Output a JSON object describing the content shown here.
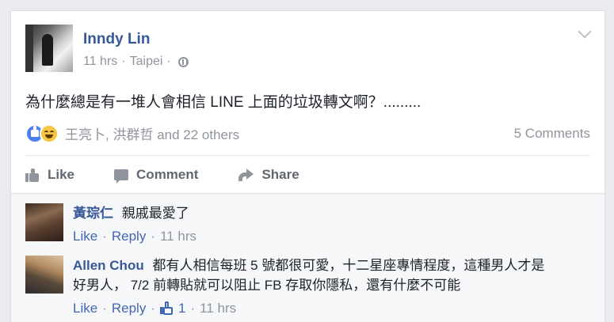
{
  "post": {
    "author": "Inndy Lin",
    "time": "11 hrs",
    "location": "Taipei",
    "text": "為什麼總是有一堆人會相信 LINE 上面的垃圾轉文啊？.........",
    "reactions": {
      "icons": [
        "like-icon",
        "haha-icon"
      ],
      "names": "王亮卜, 洪群哲",
      "others": "and 22 others"
    },
    "comment_count": "5 Comments"
  },
  "actions": {
    "like": "Like",
    "comment": "Comment",
    "share": "Share"
  },
  "comments": [
    {
      "author": "黃琮仁",
      "text": "親戚最愛了",
      "like": "Like",
      "reply": "Reply",
      "time": "11 hrs"
    },
    {
      "author": "Allen Chou",
      "text_line1": "都有人相信每班 5 號都很可愛，十二星座專情程度，這種男人才是",
      "text_line2": "好男人， 7/2 前轉貼就可以阻止 FB 存取你隱私，還有什麼不可能",
      "like": "Like",
      "reply": "Reply",
      "likes": "1",
      "time": "11 hrs"
    }
  ],
  "colors": {
    "link": "#365899",
    "meta": "#90949c",
    "background": "#e9ebee"
  }
}
